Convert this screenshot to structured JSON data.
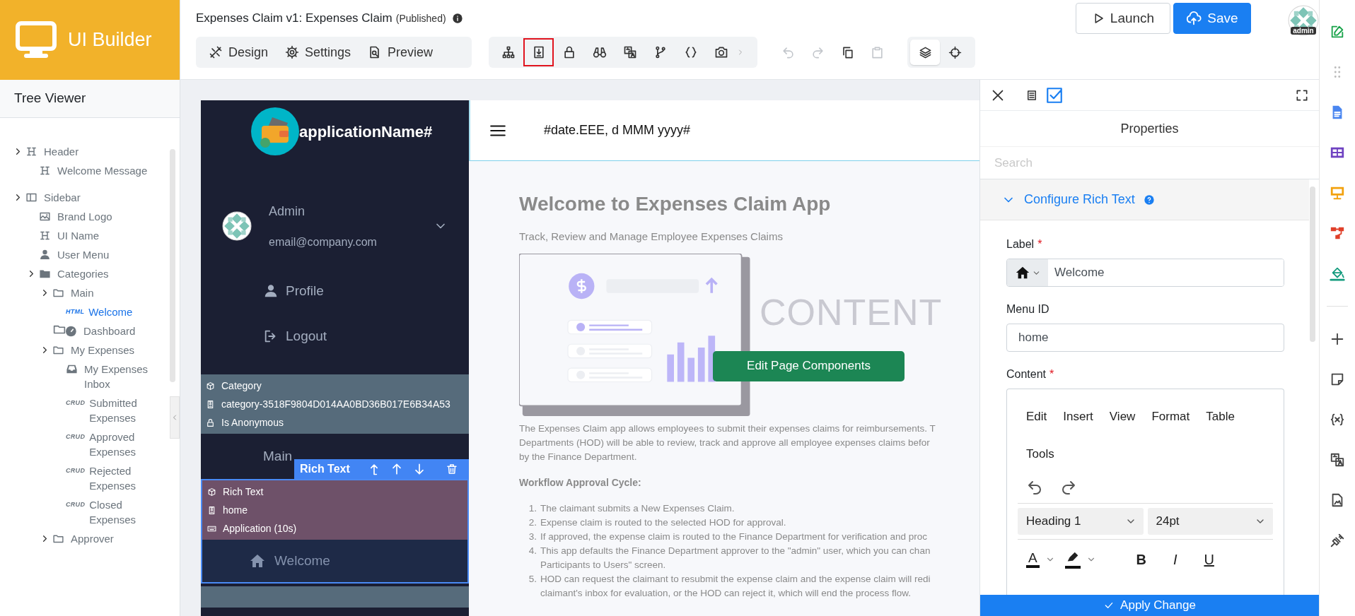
{
  "app": {
    "name": "UI Builder"
  },
  "tree_viewer": {
    "title": "Tree Viewer",
    "items": [
      {
        "label": "Header",
        "kind": "heading",
        "toggle": true,
        "selected": false,
        "children": [
          {
            "label": "Welcome Message",
            "kind": "heading",
            "toggle": false,
            "selected": false
          }
        ]
      },
      {
        "label": "Sidebar",
        "kind": "sidebar",
        "toggle": true,
        "selected": false,
        "children": [
          {
            "label": "Brand Logo",
            "kind": "image",
            "toggle": false,
            "selected": false
          },
          {
            "label": "UI Name",
            "kind": "heading",
            "toggle": false,
            "selected": false
          },
          {
            "label": "User Menu",
            "kind": "user",
            "toggle": false,
            "selected": false
          },
          {
            "label": "Categories",
            "kind": "folder-filled",
            "toggle": true,
            "selected": false,
            "children": [
              {
                "label": "Main",
                "kind": "folder",
                "toggle": true,
                "selected": false,
                "children": [
                  {
                    "label": "Welcome",
                    "kind": "tagged",
                    "badge": "HTML",
                    "toggle": false,
                    "selected": true
                  }
                ]
              },
              {
                "label": "Dashboard",
                "kind": "dashboard",
                "toggle": false,
                "selected": false
              },
              {
                "label": "My Expenses",
                "kind": "folder",
                "toggle": true,
                "selected": false,
                "children": [
                  {
                    "label": "My Expenses Inbox",
                    "kind": "inbox",
                    "toggle": false,
                    "selected": false
                  },
                  {
                    "label": "Submitted Expenses",
                    "kind": "tagged",
                    "badge": "CRUD",
                    "toggle": false,
                    "selected": false
                  },
                  {
                    "label": "Approved Expenses",
                    "kind": "tagged",
                    "badge": "CRUD",
                    "toggle": false,
                    "selected": false
                  },
                  {
                    "label": "Rejected Expenses",
                    "kind": "tagged",
                    "badge": "CRUD",
                    "toggle": false,
                    "selected": false
                  },
                  {
                    "label": "Closed Expenses",
                    "kind": "tagged",
                    "badge": "CRUD",
                    "toggle": false,
                    "selected": false
                  }
                ]
              },
              {
                "label": "Approver",
                "kind": "folder",
                "toggle": true,
                "selected": false
              }
            ]
          }
        ]
      }
    ]
  },
  "header": {
    "title": "Expenses Claim v1: Expenses Claim",
    "status": "(Published)",
    "buttons": [
      {
        "label": "Launch",
        "kind": "outline"
      },
      {
        "label": "Save",
        "kind": "primary"
      }
    ],
    "avatar_label": "admin"
  },
  "mode_tabs": [
    {
      "label": "Design"
    },
    {
      "label": "Settings"
    },
    {
      "label": "Preview"
    }
  ],
  "tools": [
    {
      "selected": false
    },
    {
      "selected": true
    },
    {
      "selected": false
    },
    {
      "selected": false
    },
    {
      "selected": false
    },
    {
      "selected": false
    },
    {
      "selected": false
    },
    {
      "selected": false
    }
  ],
  "edit_actions": [
    {
      "disabled": true
    },
    {
      "disabled": true
    },
    {
      "disabled": false
    },
    {
      "disabled": true
    }
  ],
  "view_toggles": [
    {
      "selected": true
    },
    {
      "selected": false
    }
  ],
  "preview": {
    "sidebar": {
      "app_name": "applicationName#",
      "user": {
        "name": "Admin",
        "email": "email@company.com"
      },
      "menu": [
        {
          "label": "Profile"
        },
        {
          "label": "Logout"
        }
      ],
      "category_info": [
        "Category",
        "category-3518F9804D014AA0BD36B017E6B34A53",
        "Is Anonymous"
      ],
      "category_label": "Main",
      "selection_toolbar": {
        "title": "Rich Text"
      },
      "selected_info": [
        "Rich Text",
        "home",
        "Application (10s)"
      ],
      "selected_item": "Welcome"
    },
    "topbar": {
      "date": "#date.EEE, d MMM yyyy#"
    },
    "content": {
      "title": "Welcome to Expenses Claim App",
      "subtitle": "Track, Review and Manage Employee Expenses Claims",
      "placeholder_text": "CONTENT",
      "button": "Edit Page Components",
      "paragraph": [
        "The Expenses Claim app allows employees to submit their expenses claims for reimbursements. T",
        "Departments (HOD) will be able to review, track and approve all employee expenses claims befor",
        "by the Finance Department."
      ],
      "workflow_heading": "Workflow Approval Cycle:",
      "steps": [
        {
          "number": "1.",
          "lines": [
            "The claimant submits a New Expenses Claim."
          ]
        },
        {
          "number": "2.",
          "lines": [
            "Expense claim is routed to the selected HOD for approval."
          ]
        },
        {
          "number": "3.",
          "lines": [
            "If approved, the expense claim is routed to the Finance Department for verification and proc"
          ]
        },
        {
          "number": "4.",
          "lines": [
            "This app defaults the Finance Department approver to the \"admin\" user, which you can chan",
            "Participants to Users\" screen."
          ]
        },
        {
          "number": "5.",
          "lines": [
            "HOD can request the claimant to resubmit the expense claim and the expense claim will redi",
            "claimant's inbox for evaluation, or the HOD can reject it, which will end the process flow."
          ]
        }
      ]
    }
  },
  "properties": {
    "toggle": {
      "checked": true
    },
    "title": "Properties",
    "search": {
      "placeholder": "Search"
    },
    "section": {
      "title": "Configure Rich Text",
      "expanded": true
    },
    "fields": [
      {
        "label": "Label",
        "required_mark": "*",
        "kind": "icon-input",
        "value": "Welcome"
      },
      {
        "label": "Menu ID",
        "kind": "input",
        "value": "home"
      },
      {
        "label": "Content",
        "required_mark": "*",
        "kind": "editor"
      }
    ],
    "editor": {
      "menu": [
        "Edit",
        "Insert",
        "View",
        "Format",
        "Table",
        "Tools"
      ],
      "block_format": "Heading 1",
      "font_size": "24pt",
      "font_color": "A",
      "format_buttons": [
        {
          "label": "B",
          "kind": "bold"
        },
        {
          "label": "I",
          "kind": "italic"
        },
        {
          "label": "U",
          "kind": "underline"
        }
      ]
    },
    "apply_button": "Apply Change"
  }
}
